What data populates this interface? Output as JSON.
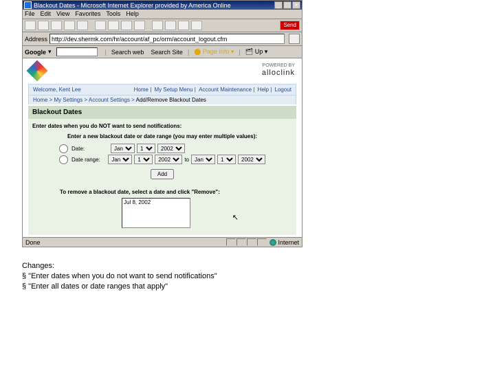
{
  "title": "Blackout Dates - Microsoft Internet Explorer provided by America Online",
  "menu": [
    "File",
    "Edit",
    "View",
    "Favorites",
    "Tools",
    "Help"
  ],
  "send_label": "Send",
  "addr_label": "Address",
  "addr_value": "http://dev.shermk.com/hr/account/af_pc/orm/account_logout.cfm",
  "google": {
    "brand": "Google",
    "search_web": "Search web",
    "search_site": "Search Site",
    "page_info": "Page Info",
    "up": "Up"
  },
  "powered": {
    "top": "POWERED BY",
    "brand": "alloclink"
  },
  "welcome": "Welcome, Kent Lee",
  "top_links": [
    "Home",
    "My Setup Menu",
    "Account Maintenance",
    "Help",
    "Logout"
  ],
  "crumb": {
    "pre": "Home > My Settings > Account Settings >",
    "here": "Add/Remove Blackout Dates"
  },
  "heading": "Blackout Dates",
  "instr1": "Enter dates when you do NOT want to send notifications:",
  "instr2": "Enter a new blackout date or date range (you may enter multiple values):",
  "opt_date": "Date:",
  "opt_range": "Date range:",
  "months": "Jan",
  "day": "1",
  "year": "2002",
  "to": "to",
  "add_label": "Add",
  "remove_instr": "To remove a blackout date, select a date and click \"Remove\":",
  "list_item": "Jul 8, 2002",
  "status_done": "Done",
  "status_zone": "Internet",
  "changes": {
    "label": "Changes:",
    "b1": "§ \"Enter dates when you do not want to send notifications\"",
    "b2": "§ \"Enter all dates or date ranges that apply\""
  }
}
